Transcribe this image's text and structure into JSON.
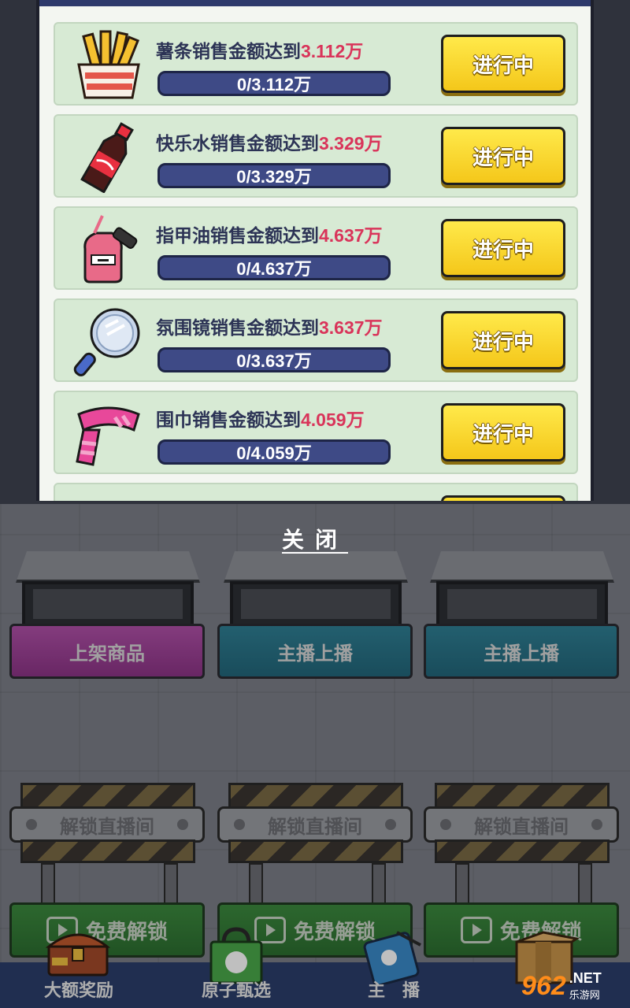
{
  "tasks": [
    {
      "icon": "fries-icon",
      "title": "薯条销售金额达到",
      "target": "3.112万",
      "progress_text": "0/3.112万",
      "progress": 0,
      "button": "进行中"
    },
    {
      "icon": "cola-bottle-icon",
      "title": "快乐水销售金额达到",
      "target": "3.329万",
      "progress_text": "0/3.329万",
      "progress": 0,
      "button": "进行中"
    },
    {
      "icon": "nail-polish-icon",
      "title": "指甲油销售金额达到",
      "target": "4.637万",
      "progress_text": "0/4.637万",
      "progress": 0,
      "button": "进行中"
    },
    {
      "icon": "mirror-icon",
      "title": "氛围镜销售金额达到",
      "target": "3.637万",
      "progress_text": "0/3.637万",
      "progress": 0,
      "button": "进行中"
    },
    {
      "icon": "scarf-icon",
      "title": "围巾销售金额达到",
      "target": "4.059万",
      "progress_text": "0/4.059万",
      "progress": 0,
      "button": "进行中"
    }
  ],
  "close_label": "关闭",
  "stands": [
    {
      "label": "上架商品",
      "color": "#a0449a"
    },
    {
      "label": "主播上播",
      "color": "#2a7488"
    },
    {
      "label": "主播上播",
      "color": "#2a7488"
    }
  ],
  "barriers": [
    {
      "sign": "解锁直播间",
      "free": "免费解锁"
    },
    {
      "sign": "解锁直播间",
      "free": "免费解锁"
    },
    {
      "sign": "解锁直播间",
      "free": "免费解锁"
    }
  ],
  "nav": [
    {
      "label": "大额奖励",
      "icon": "treasure-chest-icon"
    },
    {
      "label": "原子甄选",
      "icon": "shopping-bag-icon"
    },
    {
      "label": "主　播",
      "icon": "badge-icon"
    },
    {
      "label": "",
      "icon": "crate-icon"
    }
  ],
  "watermark": {
    "num": "962",
    "net": ".NET",
    "site": "乐游网"
  },
  "colors": {
    "accent_red": "#d9345a",
    "button_yellow": "#f9dc2c",
    "panel_green": "#d7ead4"
  }
}
